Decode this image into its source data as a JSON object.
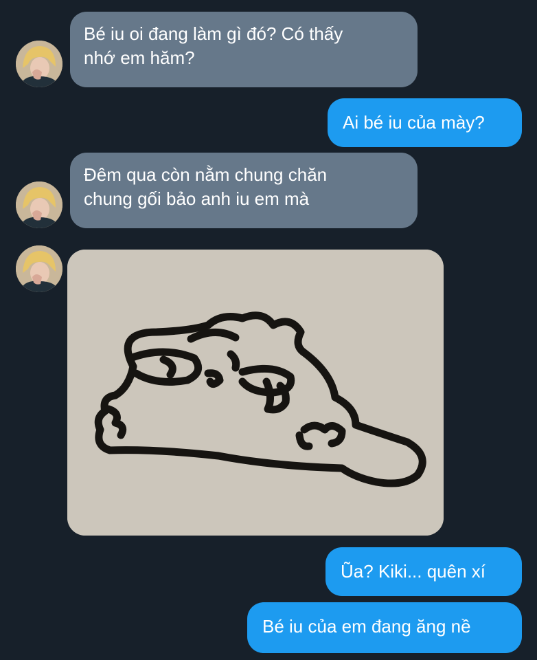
{
  "conversation": {
    "messages": [
      {
        "side": "incoming",
        "text": "Bé iu oi đang làm gì đó? Có thấy\nnhớ em hăm?"
      },
      {
        "side": "outgoing",
        "text": "Ai bé iu của mày?"
      },
      {
        "side": "incoming",
        "text": "Đêm qua còn nằm chung chăn\nchung gối bảo anh iu em mà"
      },
      {
        "side": "outgoing",
        "text": "Ũa? Kiki... quên xí"
      },
      {
        "side": "outgoing",
        "text": "Bé iu của em đang ăng nề"
      }
    ],
    "sticker": {
      "icon": "crying-blob-sticker"
    },
    "avatar": {
      "icon": "user-avatar-icon"
    }
  },
  "colors": {
    "background": "#17202a",
    "incoming_bubble": "#66788a",
    "outgoing_bubble": "#1d9bf0",
    "sticker_background": "#ccc6bb"
  }
}
